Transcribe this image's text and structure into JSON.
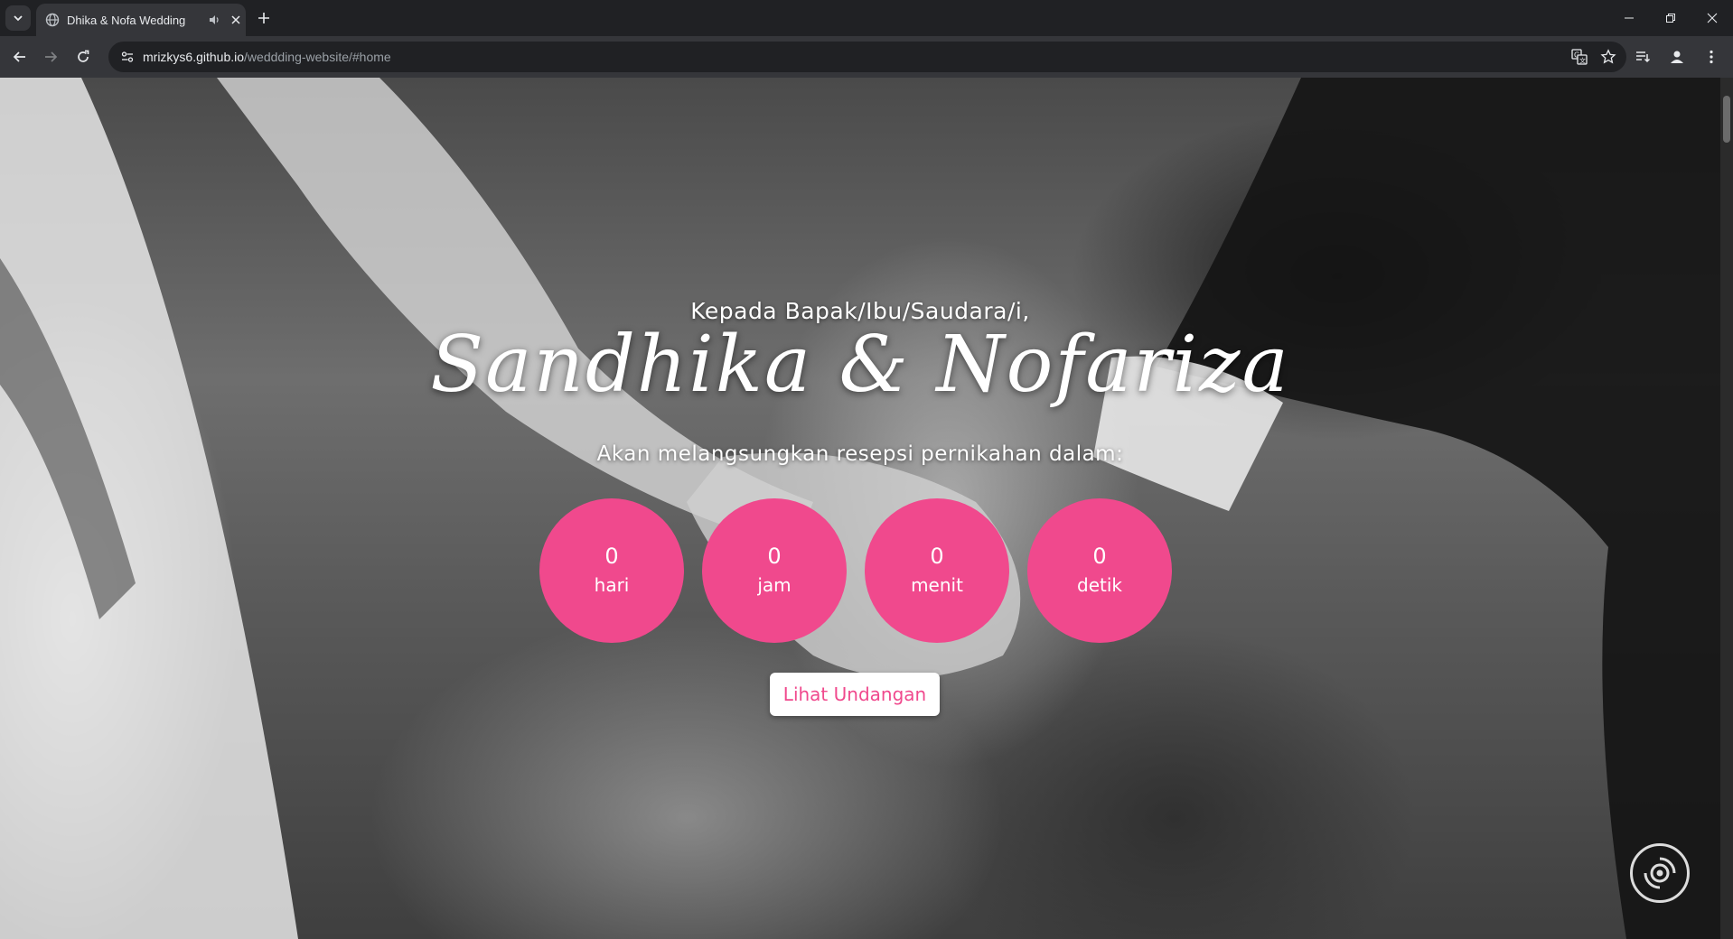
{
  "browser": {
    "tab": {
      "title": "Dhika & Nofa Wedding",
      "favicon": "globe-icon",
      "audio_icon": "speaker-icon",
      "close_icon": "close-icon"
    },
    "new_tab_icon": "plus-icon",
    "window_controls": [
      "minimize-icon",
      "restore-icon",
      "close-icon"
    ],
    "address": {
      "host": "mrizkys6.github.io",
      "path": "/weddding-website/#home"
    },
    "nav_icons": [
      "back-icon",
      "forward-icon",
      "reload-icon"
    ],
    "omnibox_icons": [
      "translate-icon",
      "star-icon"
    ],
    "toolbar_icons": [
      "reading-list-icon",
      "profile-icon",
      "menu-icon"
    ]
  },
  "hero": {
    "greeting": "Kepada Bapak/Ibu/Saudara/i,",
    "names": "Sandhika & Nofariza",
    "subtitle": "Akan melangsungkan resepsi pernikahan dalam:",
    "countdown": [
      {
        "value": "0",
        "unit": "hari"
      },
      {
        "value": "0",
        "unit": "jam"
      },
      {
        "value": "0",
        "unit": "menit"
      },
      {
        "value": "0",
        "unit": "detik"
      }
    ],
    "cta_label": "Lihat Undangan",
    "music_icon": "music-disc-icon"
  },
  "colors": {
    "accent": "#f0498d",
    "chrome_dark": "#202124",
    "chrome_toolbar": "#35363a"
  }
}
